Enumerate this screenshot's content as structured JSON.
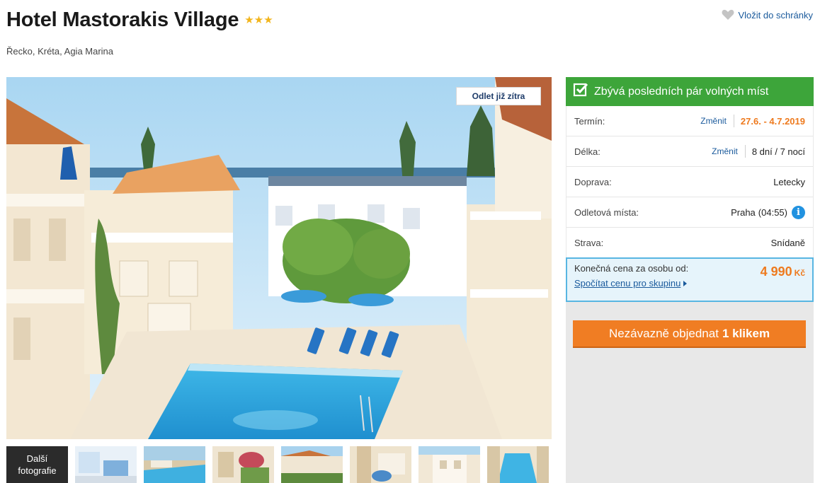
{
  "hotel": {
    "name": "Hotel Mastorakis Village",
    "stars": "★★★",
    "location": "Řecko, Kréta, Agia Marina"
  },
  "save": {
    "label": "Vložit do schránky",
    "icon": "heart-icon"
  },
  "gallery": {
    "badge": "Odlet již zítra",
    "more_line1": "Další",
    "more_line2": "fotografie",
    "thumbnail_count": 7
  },
  "panel": {
    "banner": "Zbývá posledních pár volných míst",
    "banner_icon": "checkbox-checked-icon",
    "rows": [
      {
        "label": "Termín:",
        "change": "Změnit",
        "value": "27.6. - 4.7.2019"
      },
      {
        "label": "Délka:",
        "change": "Změnit",
        "value": "8 dní / 7 nocí"
      },
      {
        "label": "Doprava:",
        "value": "Letecky"
      },
      {
        "label": "Odletová místa:",
        "value": "Praha",
        "time": "(04:55)",
        "info_icon": "info-icon"
      },
      {
        "label": "Strava:",
        "value": "Snídaně"
      }
    ],
    "price": {
      "label": "Konečná cena za osobu od:",
      "amount": "4 990",
      "currency": "Kč",
      "group_link": "Spočítat cenu pro skupinu"
    },
    "order": {
      "text": "Nezávazně objednat",
      "bold": "1 klikem"
    }
  },
  "colors": {
    "accent_orange": "#f07d23",
    "banner_green": "#3da53a",
    "link_blue": "#1a5a9c",
    "price_border": "#58b6e2",
    "star_gold": "#f2b51c"
  }
}
